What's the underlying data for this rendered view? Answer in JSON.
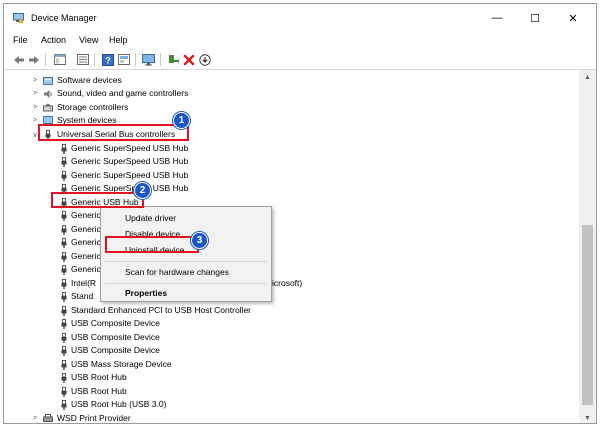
{
  "window": {
    "title": "Device Manager",
    "controls": {
      "minimize": "—",
      "maximize": "☐",
      "close": "✕"
    }
  },
  "menu": [
    "File",
    "Action",
    "View",
    "Help"
  ],
  "toolbar": [
    "back-arrow-icon",
    "forward-arrow-icon",
    "properties-icon",
    "device-list-icon",
    "help-icon",
    "update-driver-icon",
    "monitor-icon",
    "add-driver-icon",
    "uninstall-x-icon",
    "download-icon"
  ],
  "tree": {
    "categories_top": [
      {
        "label": "Software devices",
        "icon": "software-icon"
      },
      {
        "label": "Sound, video and game controllers",
        "icon": "speaker-icon"
      },
      {
        "label": "Storage controllers",
        "icon": "storage-icon"
      },
      {
        "label": "System devices",
        "icon": "system-icon"
      }
    ],
    "usb_category": {
      "label": "Universal Serial Bus controllers",
      "expanded": true
    },
    "usb_children": [
      "Generic SuperSpeed USB Hub",
      "Generic SuperSpeed USB Hub",
      "Generic SuperSpeed USB Hub",
      "Generic SuperSpeed USB Hub",
      "Generic USB Hub",
      "Generic",
      "Generic",
      "Generic",
      "Generic",
      "Generic",
      "Intel(R",
      "Stand",
      "Standard Enhanced PCI to USB Host Controller",
      "USB Composite Device",
      "USB Composite Device",
      "USB Composite Device",
      "USB Mass Storage Device",
      "USB Root Hub",
      "USB Root Hub",
      "USB Root Hub (USB 3.0)"
    ],
    "intel_suffix": "icrosoft)",
    "categories_bottom": [
      {
        "label": "WSD Print Provider",
        "icon": "printer-icon"
      }
    ]
  },
  "context_menu": {
    "items": [
      "Update driver",
      "Disable device",
      "Uninstall device",
      "Scan for hardware changes",
      "Properties"
    ]
  },
  "annotations": {
    "badges": [
      "1",
      "2",
      "3"
    ],
    "highlight_color": "#e0141e",
    "badge_color": "#1b55c9"
  }
}
